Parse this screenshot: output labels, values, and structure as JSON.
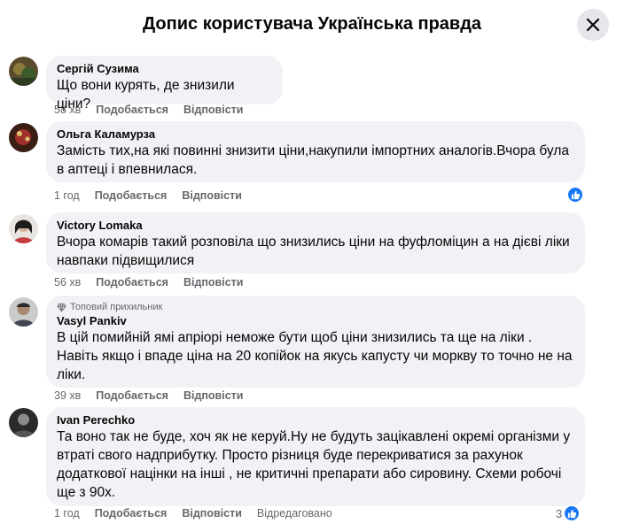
{
  "header": {
    "title": "Допис користувача Українська правда"
  },
  "icons": {
    "close": "close-icon",
    "like": "thumbs-up-icon",
    "top_fan": "diamond-icon"
  },
  "colors": {
    "bubble": "#f0f2f5",
    "meta": "#65676b",
    "like": "#1877f2"
  },
  "comments": [
    {
      "author": "Сергій Сузима",
      "lines": [
        "Що вони курять, де знизили ціни?"
      ],
      "time": "58 хв",
      "like_label": "Подобається",
      "reply_label": "Відповісти"
    },
    {
      "author": "Ольга Каламурза",
      "lines": [
        "Замість тих,на які повинні знизити ціни,накупили імпортних аналогів.Вчора була",
        "в аптеці і впевнилася."
      ],
      "time": "1 год",
      "like_label": "Подобається",
      "reply_label": "Відповісти"
    },
    {
      "author": "Victory Lomaka",
      "lines": [
        "Вчора комарів такий розповіла що знизились ціни на фуфломіцин а на дієві ліки",
        "навпаки підвищилися"
      ],
      "time": "56 хв",
      "like_label": "Подобається",
      "reply_label": "Відповісти"
    },
    {
      "badge": "Топовий прихильник",
      "author": "Vasyl Pankiv",
      "lines": [
        "В цій помийній ямі апріорі неможе бути щоб ціни знизились та ще на ліки .",
        "Навіть якщо і впаде ціна на 20 копійок на якусь капусту чи моркву то точно не на",
        "ліки."
      ],
      "time": "39 хв",
      "like_label": "Подобається",
      "reply_label": "Відповісти"
    },
    {
      "author": "Ivan Perechko",
      "lines": [
        "Та воно так не буде, хоч як не керуй.Ну не будуть зацікавлені окремі організми у",
        "втраті свого надприбутку. Просто різниця буде перекриватися за рахунок",
        "додаткової націнки на інші , не критичні препарати або сировину. Схеми робочі",
        "ще з 90х."
      ],
      "time": "1 год",
      "like_label": "Подобається",
      "reply_label": "Відповісти",
      "edited": "Відредаговано",
      "reaction_count": "3"
    }
  ]
}
